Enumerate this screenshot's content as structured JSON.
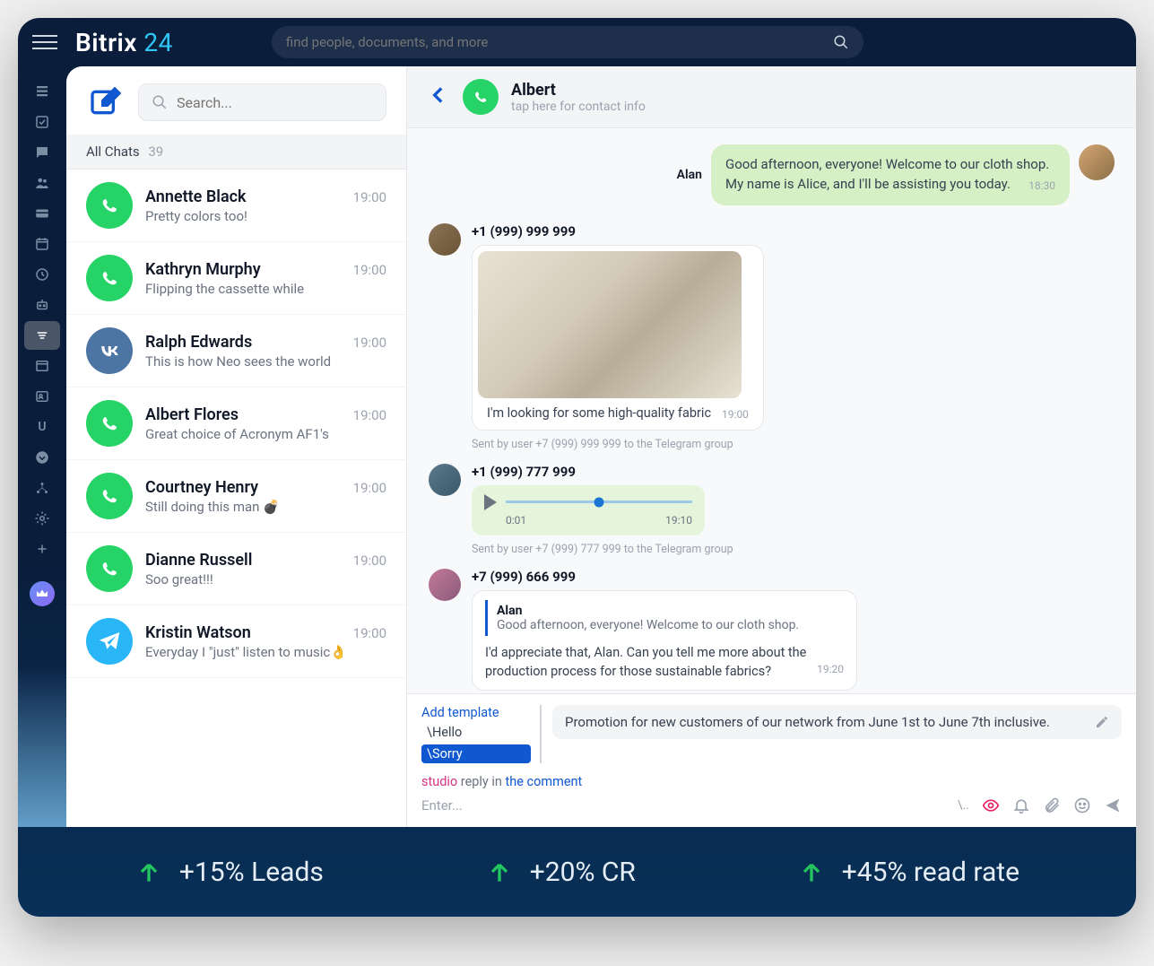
{
  "header": {
    "logo_main": "Bitrix",
    "logo_num": "24",
    "search_placeholder": "find people, documents, and more"
  },
  "chatlist": {
    "search_placeholder": "Search...",
    "tab_label": "All Chats",
    "tab_count": "39",
    "items": [
      {
        "name": "Annette Black",
        "preview": "Pretty colors too!",
        "time": "19:00",
        "icon": "whatsapp"
      },
      {
        "name": "Kathryn Murphy",
        "preview": "Flipping the cassette while",
        "time": "19:00",
        "icon": "whatsapp"
      },
      {
        "name": "Ralph Edwards",
        "preview": "This is how Neo sees the world",
        "time": "19:00",
        "icon": "vk"
      },
      {
        "name": "Albert Flores",
        "preview": "Great choice of Acronym AF1's",
        "time": "19:00",
        "icon": "whatsapp"
      },
      {
        "name": "Courtney Henry",
        "preview": "Still doing this man 💣",
        "time": "19:00",
        "icon": "whatsapp"
      },
      {
        "name": "Dianne Russell",
        "preview": "Soo great!!!",
        "time": "19:00",
        "icon": "whatsapp"
      },
      {
        "name": "Kristin Watson",
        "preview": "Everyday I \"just\" listen to music👌",
        "time": "19:00",
        "icon": "telegram"
      }
    ]
  },
  "chat": {
    "title": "Albert",
    "subtitle": "tap here for contact info",
    "out_sender": "Alan",
    "out_text": "Good afternoon, everyone! Welcome to our cloth shop. My name is Alice, and I'll be assisting you today.",
    "out_time": "18:30",
    "msg1_name": "+1 (999) 999 999",
    "msg1_caption": "I'm looking for some high-quality fabric",
    "msg1_time": "19:00",
    "msg1_meta": "Sent by user +7 (999) 999 999 to the Telegram group",
    "msg2_name": "+1 (999) 777 999",
    "msg2_start": "0:01",
    "msg2_end": "19:10",
    "msg2_meta": "Sent by user +7 (999) 777 999 to the Telegram group",
    "msg3_name": "+7 (999) 666 999",
    "msg3_quote_name": "Alan",
    "msg3_quote_text": "Good afternoon, everyone! Welcome to our cloth shop.",
    "msg3_body": "I'd appreciate that, Alan. Can you tell me more about the production process for those sustainable fabrics?",
    "msg3_time": "19:20"
  },
  "compose": {
    "add_template": "Add template",
    "opt1": "\\Hello",
    "opt2": "\\Sorry",
    "template_preview": "Promotion for new customers of our network from June 1st to June 7th inclusive.",
    "hint_a": "studio",
    "hint_b": " reply in ",
    "hint_c": "the comment",
    "placeholder": "Enter...",
    "slash": "\\.."
  },
  "stats": {
    "s1": "+15% Leads",
    "s2": "+20% CR",
    "s3": "+45% read rate"
  }
}
